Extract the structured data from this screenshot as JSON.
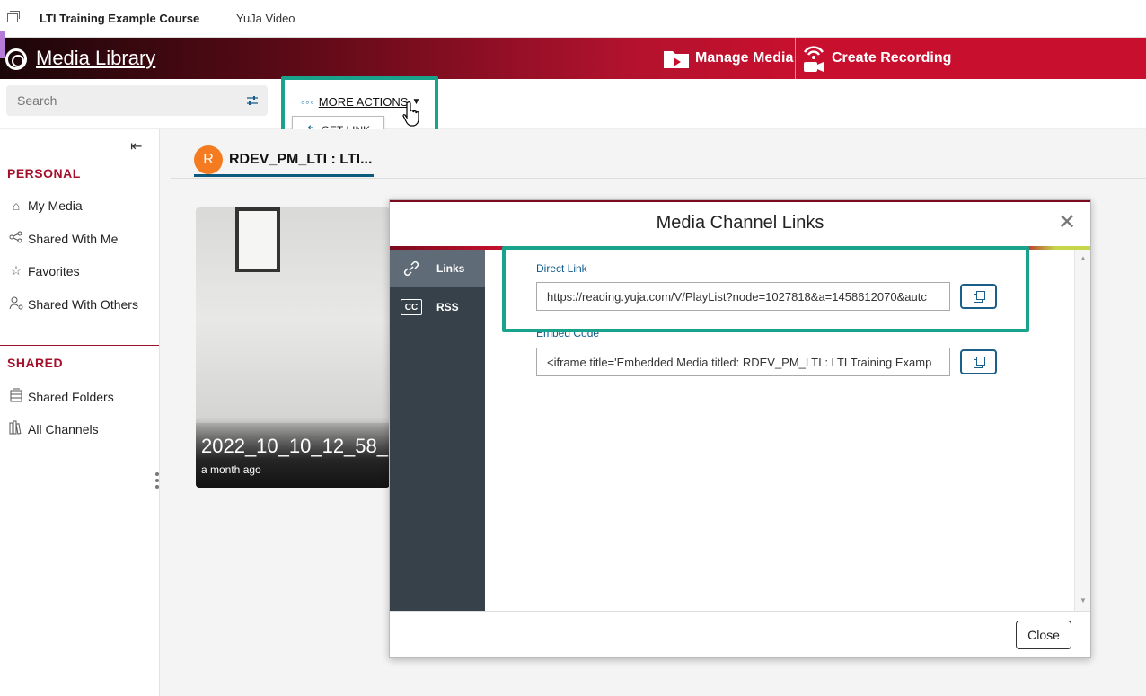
{
  "topbar": {
    "course": "LTI Training Example Course",
    "tool": "YuJa Video"
  },
  "header": {
    "title": "Media Library",
    "manage_media": "Manage Media",
    "create_recording": "Create Recording"
  },
  "search": {
    "placeholder": "Search"
  },
  "actions": {
    "more_dots": "◦◦◦",
    "more": "MORE ACTIONS",
    "get_link": "GET LINK"
  },
  "sidebar": {
    "personal_title": "PERSONAL",
    "personal_items": [
      {
        "label": "My Media",
        "icon": "home-icon"
      },
      {
        "label": "Shared With Me",
        "icon": "share-icon"
      },
      {
        "label": "Favorites",
        "icon": "star-icon"
      },
      {
        "label": "Shared With Others",
        "icon": "user-share-icon"
      }
    ],
    "shared_title": "SHARED",
    "shared_items": [
      {
        "label": "Shared Folders",
        "icon": "folders-icon"
      },
      {
        "label": "All Channels",
        "icon": "channels-icon"
      }
    ]
  },
  "channel_tab": {
    "avatar": "R",
    "name": "RDEV_PM_LTI : LTI..."
  },
  "media_card": {
    "title": "2022_10_10_12_58_",
    "date": "a month ago"
  },
  "dialog": {
    "title": "Media Channel Links",
    "tabs": [
      {
        "label": "Links",
        "icon": "link-icon"
      },
      {
        "label": "RSS",
        "icon": "cc-icon",
        "icon_text": "CC"
      }
    ],
    "direct_link_label": "Direct Link",
    "direct_link_value": "https://reading.yuja.com/V/PlayList?node=1027818&a=1458612070&autc",
    "embed_label": "Embed Code",
    "embed_value": "<iframe title='Embedded Media titled: RDEV_PM_LTI : LTI Training Examp",
    "close_button": "Close"
  },
  "colors": {
    "brand_red": "#c8102e",
    "highlight_teal": "#1aa38c",
    "link_blue": "#0e5a8a",
    "avatar_orange": "#f47b20"
  }
}
